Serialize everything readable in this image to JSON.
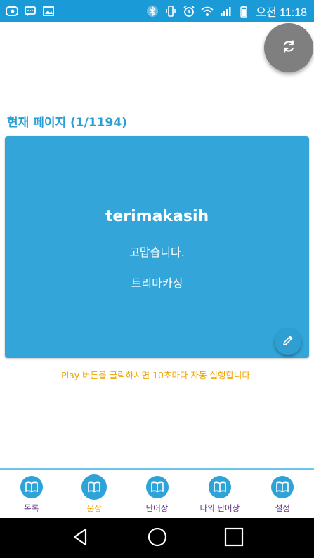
{
  "status_bar": {
    "left_icons": [
      "app-icon",
      "messenger-icon",
      "gallery-icon"
    ],
    "right_icons": [
      "bluetooth-icon",
      "vibrate-icon",
      "alarm-icon",
      "wifi-icon",
      "signal-icon",
      "battery-icon"
    ],
    "time": "오전 11:18"
  },
  "page": {
    "title": "현재 페이지 (1/1194)"
  },
  "card": {
    "word": "terimakasih",
    "meaning": "고맙습니다.",
    "pronunciation": "트리마카싱"
  },
  "hint": "Play 버튼을 클릭하시면 10초마다 자동 실행합니다.",
  "bottom_nav": {
    "items": [
      {
        "label": "목록",
        "icon": "book-icon",
        "active": false
      },
      {
        "label": "문장",
        "icon": "book-icon",
        "active": true
      },
      {
        "label": "단어장",
        "icon": "book-icon",
        "active": false
      },
      {
        "label": "나의 단어장",
        "icon": "book-icon",
        "active": false
      },
      {
        "label": "설정",
        "icon": "book-icon",
        "active": false
      }
    ]
  },
  "colors": {
    "status_bar": "#1a9bd8",
    "accent": "#2a9fd6",
    "card": "#33a5d8",
    "hint": "#f0a400",
    "nav_label": "#5a2a7a",
    "fab_gray": "#7f7f7f"
  }
}
